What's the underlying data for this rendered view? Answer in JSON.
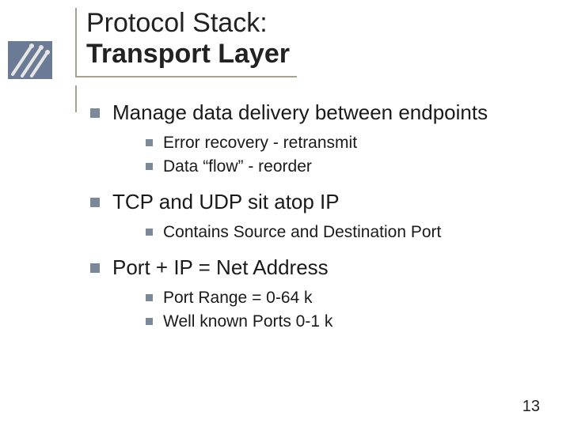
{
  "title": {
    "line1": "Protocol Stack:",
    "line2": "Transport Layer"
  },
  "bullets": [
    {
      "text": "Manage data delivery between endpoints",
      "sub": [
        "Error recovery - retransmit",
        "Data “flow” - reorder"
      ]
    },
    {
      "text": "TCP and UDP sit atop IP",
      "sub": [
        "Contains Source and Destination Port"
      ]
    },
    {
      "text": "Port + IP = Net Address",
      "sub": [
        "Port Range = 0-64 k",
        "Well known Ports 0-1 k"
      ]
    }
  ],
  "page_number": "13",
  "logo_colors": {
    "bg": "#6b7b95",
    "stroke": "#e6e6e6"
  }
}
